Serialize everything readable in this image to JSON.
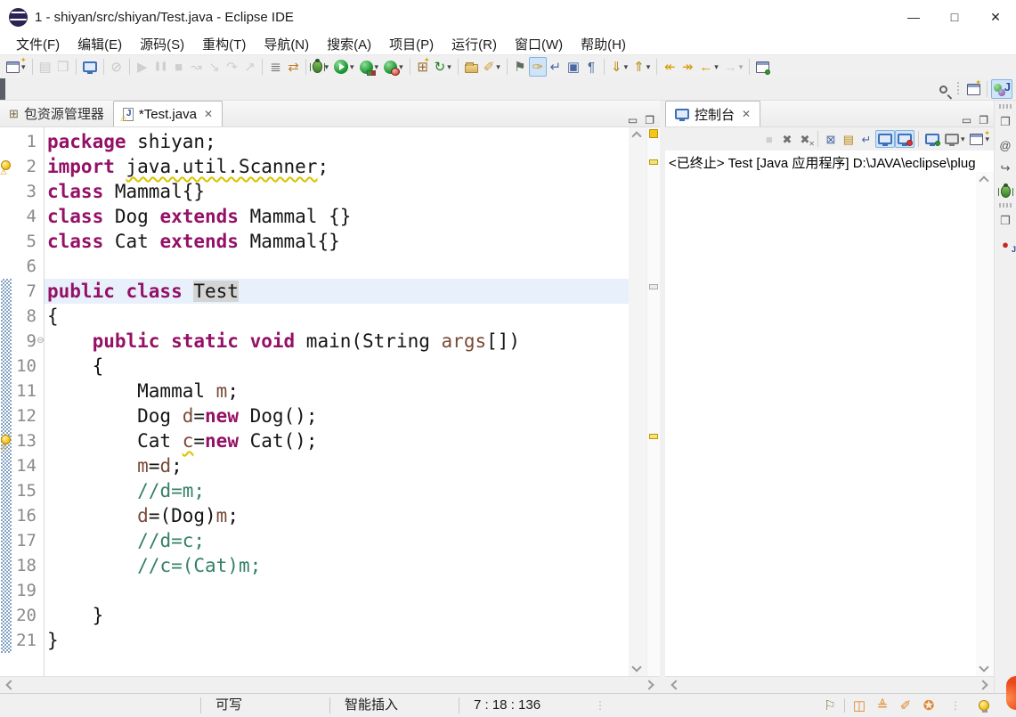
{
  "window": {
    "title": "1 - shiyan/src/shiyan/Test.java - Eclipse IDE",
    "controls": [
      {
        "name": "minimize-button",
        "glyph": "—"
      },
      {
        "name": "maximize-button",
        "glyph": "□"
      },
      {
        "name": "close-button",
        "glyph": "✕"
      }
    ]
  },
  "menu_bar": {
    "items": [
      "文件(F)",
      "编辑(E)",
      "源码(S)",
      "重构(T)",
      "导航(N)",
      "搜索(A)",
      "项目(P)",
      "运行(R)",
      "窗口(W)",
      "帮助(H)"
    ]
  },
  "toolbar": {
    "groups": [
      [
        {
          "name": "new-wizard-button",
          "shape": "window",
          "star": true,
          "dd": true
        }
      ],
      [
        {
          "name": "save-button",
          "glyph": "▤",
          "color": "#7f95c2",
          "disabled": true
        },
        {
          "name": "save-all-button",
          "glyph": "❒",
          "color": "#7f95c2",
          "disabled": true
        }
      ],
      [
        {
          "name": "open-task-button",
          "shape": "monitor"
        }
      ],
      [
        {
          "name": "link-editor-button",
          "glyph": "⊘",
          "color": "#8a8a8a",
          "disabled": true
        }
      ],
      [
        {
          "name": "resume-button",
          "glyph": "▶",
          "color": "#9aa5ad",
          "disabled": true
        },
        {
          "name": "pause-button",
          "glyph": "❚❚",
          "color": "#9aa5ad",
          "disabled": true,
          "small": true
        },
        {
          "name": "terminate-button",
          "glyph": "■",
          "color": "#9aa5ad",
          "disabled": true
        },
        {
          "name": "disconnect-button",
          "glyph": "↝",
          "color": "#9aa5ad",
          "disabled": true
        },
        {
          "name": "step-into-button",
          "glyph": "↘",
          "color": "#9aa5ad",
          "disabled": true
        },
        {
          "name": "step-over-button",
          "glyph": "↷",
          "color": "#9aa5ad",
          "disabled": true
        },
        {
          "name": "step-return-button",
          "glyph": "↗",
          "color": "#9aa5ad",
          "disabled": true
        }
      ],
      [
        {
          "name": "skip-breakpoints-button",
          "glyph": "≣",
          "color": "#6b6b6b"
        },
        {
          "name": "step-filters-button",
          "glyph": "⇄",
          "color": "#c27f2a"
        }
      ],
      [
        {
          "name": "debug-button",
          "shape": "bug",
          "dd": true
        },
        {
          "name": "run-button",
          "shape": "run",
          "dd": true
        },
        {
          "name": "coverage-button",
          "shape": "coverage",
          "dd": true
        },
        {
          "name": "profile-button",
          "shape": "profile",
          "dd": true
        }
      ],
      [
        {
          "name": "new-java-project-button",
          "glyph": "⊞",
          "color": "#9c6b30",
          "star": true
        },
        {
          "name": "new-class-button",
          "glyph": "↻",
          "color": "#1e7e1e",
          "dd": true
        }
      ],
      [
        {
          "name": "open-type-button",
          "shape": "folder"
        },
        {
          "name": "search-button",
          "glyph": "✐",
          "color": "#c99b2e",
          "dd": true
        }
      ],
      [
        {
          "name": "task-tag-button",
          "glyph": "⚑",
          "color": "#5e6e5e"
        },
        {
          "name": "mark-occurrences-button",
          "glyph": "✑",
          "color": "#c99b2e",
          "active": true
        },
        {
          "name": "show-return-button",
          "glyph": "↵",
          "color": "#4a67a0"
        },
        {
          "name": "show-selected-element-button",
          "glyph": "▣",
          "color": "#4a67a0"
        },
        {
          "name": "show-whitespace-button",
          "glyph": "¶",
          "color": "#4a67a0"
        }
      ],
      [
        {
          "name": "next-annotation-button",
          "glyph": "⇓",
          "color": "#b8860b",
          "dd": true
        },
        {
          "name": "prev-annotation-button",
          "glyph": "⇑",
          "color": "#b8860b",
          "dd": true
        }
      ],
      [
        {
          "name": "last-edit-back-button",
          "glyph": "↞",
          "color": "#d79b00"
        },
        {
          "name": "last-edit-forward-button",
          "glyph": "↠",
          "color": "#d79b00"
        },
        {
          "name": "back-history-button",
          "glyph": "←",
          "color": "#d79b00",
          "dd": true
        },
        {
          "name": "forward-history-button",
          "glyph": "→",
          "color": "#a8a8a8",
          "disabled": true,
          "dd": true
        }
      ],
      [
        {
          "name": "pin-editor-button",
          "shape": "window",
          "pin": true
        }
      ]
    ]
  },
  "perspective_bar": {
    "search_icon": "search-icon",
    "open_perspective_icon": "open-perspective-icon",
    "java_perspective_label": "J"
  },
  "editor_tabs": [
    {
      "name": "tab-package-explorer",
      "label": "包资源管理器",
      "icon": "package",
      "icon_glyph": "⊞",
      "selected": false
    },
    {
      "name": "tab-test-java",
      "label": "*Test.java",
      "icon": "jfile",
      "icon_letter": "J",
      "selected": true,
      "closable": true,
      "close_glyph": "✕"
    }
  ],
  "editor": {
    "range": {
      "start": 7,
      "end": 21
    },
    "fold_glyph": "⊖",
    "warning_overlay_glyph": "⚠",
    "overview": {
      "top_square": true,
      "markers": [
        {
          "line": 2,
          "kind": "warning"
        },
        {
          "line": 7,
          "kind": "occurrence"
        },
        {
          "line": 13,
          "kind": "warning"
        }
      ]
    },
    "lines": [
      {
        "n": 1,
        "segs": [
          [
            "k",
            "package"
          ],
          [
            "p",
            " shiyan;"
          ]
        ]
      },
      {
        "n": 2,
        "segs": [
          [
            "k",
            "import"
          ],
          [
            "p",
            " "
          ],
          [
            "wu",
            "java.util.Scanner"
          ],
          [
            "p",
            ";"
          ]
        ],
        "warn": true
      },
      {
        "n": 3,
        "segs": [
          [
            "k",
            "class"
          ],
          [
            "p",
            " Mammal{}"
          ]
        ]
      },
      {
        "n": 4,
        "segs": [
          [
            "k",
            "class"
          ],
          [
            "p",
            " Dog "
          ],
          [
            "k",
            "extends"
          ],
          [
            "p",
            " Mammal {}"
          ]
        ]
      },
      {
        "n": 5,
        "segs": [
          [
            "k",
            "class"
          ],
          [
            "p",
            " Cat "
          ],
          [
            "k",
            "extends"
          ],
          [
            "p",
            " Mammal{}"
          ]
        ]
      },
      {
        "n": 6,
        "segs": []
      },
      {
        "n": 7,
        "segs": [
          [
            "k",
            "public class"
          ],
          [
            "p",
            " "
          ],
          [
            "occ",
            "Test"
          ]
        ],
        "current": true
      },
      {
        "n": 8,
        "segs": [
          [
            "p",
            "{"
          ]
        ]
      },
      {
        "n": 9,
        "segs": [
          [
            "p",
            "    "
          ],
          [
            "k",
            "public static void"
          ],
          [
            "p",
            " main(String "
          ],
          [
            "v",
            "args"
          ],
          [
            "p",
            "[])"
          ]
        ],
        "fold": true
      },
      {
        "n": 10,
        "segs": [
          [
            "p",
            "    {"
          ]
        ]
      },
      {
        "n": 11,
        "segs": [
          [
            "p",
            "        Mammal "
          ],
          [
            "v",
            "m"
          ],
          [
            "p",
            ";"
          ]
        ]
      },
      {
        "n": 12,
        "segs": [
          [
            "p",
            "        Dog "
          ],
          [
            "v",
            "d"
          ],
          [
            "p",
            "="
          ],
          [
            "k",
            "new"
          ],
          [
            "p",
            " Dog();"
          ]
        ]
      },
      {
        "n": 13,
        "segs": [
          [
            "p",
            "        Cat "
          ],
          [
            "vwu",
            "c"
          ],
          [
            "p",
            "="
          ],
          [
            "k",
            "new"
          ],
          [
            "p",
            " Cat();"
          ]
        ],
        "warn": true
      },
      {
        "n": 14,
        "segs": [
          [
            "p",
            "        "
          ],
          [
            "v",
            "m"
          ],
          [
            "p",
            "="
          ],
          [
            "v",
            "d"
          ],
          [
            "p",
            ";"
          ]
        ]
      },
      {
        "n": 15,
        "segs": [
          [
            "p",
            "        "
          ],
          [
            "c",
            "//d=m;"
          ]
        ]
      },
      {
        "n": 16,
        "segs": [
          [
            "p",
            "        "
          ],
          [
            "v",
            "d"
          ],
          [
            "p",
            "=(Dog)"
          ],
          [
            "v",
            "m"
          ],
          [
            "p",
            ";"
          ]
        ]
      },
      {
        "n": 17,
        "segs": [
          [
            "p",
            "        "
          ],
          [
            "c",
            "//d=c;"
          ]
        ]
      },
      {
        "n": 18,
        "segs": [
          [
            "p",
            "        "
          ],
          [
            "c",
            "//c=(Cat)m;"
          ]
        ]
      },
      {
        "n": 19,
        "segs": []
      },
      {
        "n": 20,
        "segs": [
          [
            "p",
            "    }"
          ]
        ]
      },
      {
        "n": 21,
        "segs": [
          [
            "p",
            "}"
          ]
        ]
      }
    ]
  },
  "console": {
    "tab_label": "控制台",
    "tab_close_glyph": "✕",
    "launch_label": "<已终止> Test [Java 应用程序] D:\\JAVA\\eclipse\\plug",
    "toolbar": [
      [
        {
          "name": "console-terminate-button",
          "glyph": "■",
          "color": "#9aa5ad",
          "disabled": true
        },
        {
          "name": "remove-launch-button",
          "glyph": "✖",
          "color": "#6f6f6f"
        },
        {
          "name": "remove-all-launches-button",
          "glyph": "✖",
          "color": "#6f6f6f",
          "double": true
        }
      ],
      [
        {
          "name": "clear-console-button",
          "glyph": "⊠",
          "color": "#4a67a0"
        },
        {
          "name": "scroll-lock-button",
          "glyph": "▤",
          "color": "#b8860b"
        },
        {
          "name": "word-wrap-button",
          "glyph": "↵",
          "color": "#4a67a0"
        },
        {
          "name": "show-stdout-button",
          "shape": "monitor",
          "active": true
        },
        {
          "name": "show-stderr-button",
          "shape": "monitor",
          "err": true,
          "active": true
        }
      ],
      [
        {
          "name": "pin-console-button",
          "shape": "monitor",
          "pin": true
        },
        {
          "name": "display-console-button",
          "shape": "monitor",
          "gray": true,
          "dd": true
        },
        {
          "name": "open-console-button",
          "shape": "window",
          "star": true,
          "dd": true
        }
      ]
    ]
  },
  "right_strip": [
    {
      "name": "restore-views-button",
      "glyph": "❐",
      "color": "#5a5a5a"
    },
    {
      "name": "javadoc-view-button",
      "glyph": "@",
      "color": "#555555"
    },
    {
      "name": "declaration-view-button",
      "glyph": "↪",
      "color": "#555555"
    },
    {
      "name": "debug-view-button",
      "shape": "bug"
    },
    {
      "name": "restore-views-button-2",
      "glyph": "❐",
      "color": "#5a5a5a",
      "gap": true
    },
    {
      "name": "junit-view-button",
      "glyph": "●",
      "color": "#cc2222",
      "letter": "J"
    }
  ],
  "status_bar": {
    "writable": "可写",
    "input_mode": "智能插入",
    "position": "7 : 18 : 136",
    "icons": [
      {
        "name": "whats-new-button",
        "glyph": "⚐",
        "color": "#8a7a4a"
      },
      {
        "sep": true
      },
      {
        "name": "documentation-button",
        "glyph": "◫",
        "color": "#e0862d"
      },
      {
        "name": "learn-button",
        "glyph": "≜",
        "color": "#e0862d"
      },
      {
        "name": "tips-button",
        "glyph": "✐",
        "color": "#e0862d"
      },
      {
        "name": "community-button",
        "glyph": "✪",
        "color": "#e0862d"
      },
      {
        "dots": true
      },
      {
        "name": "notification-bulb-button",
        "shape": "bulb"
      }
    ]
  }
}
